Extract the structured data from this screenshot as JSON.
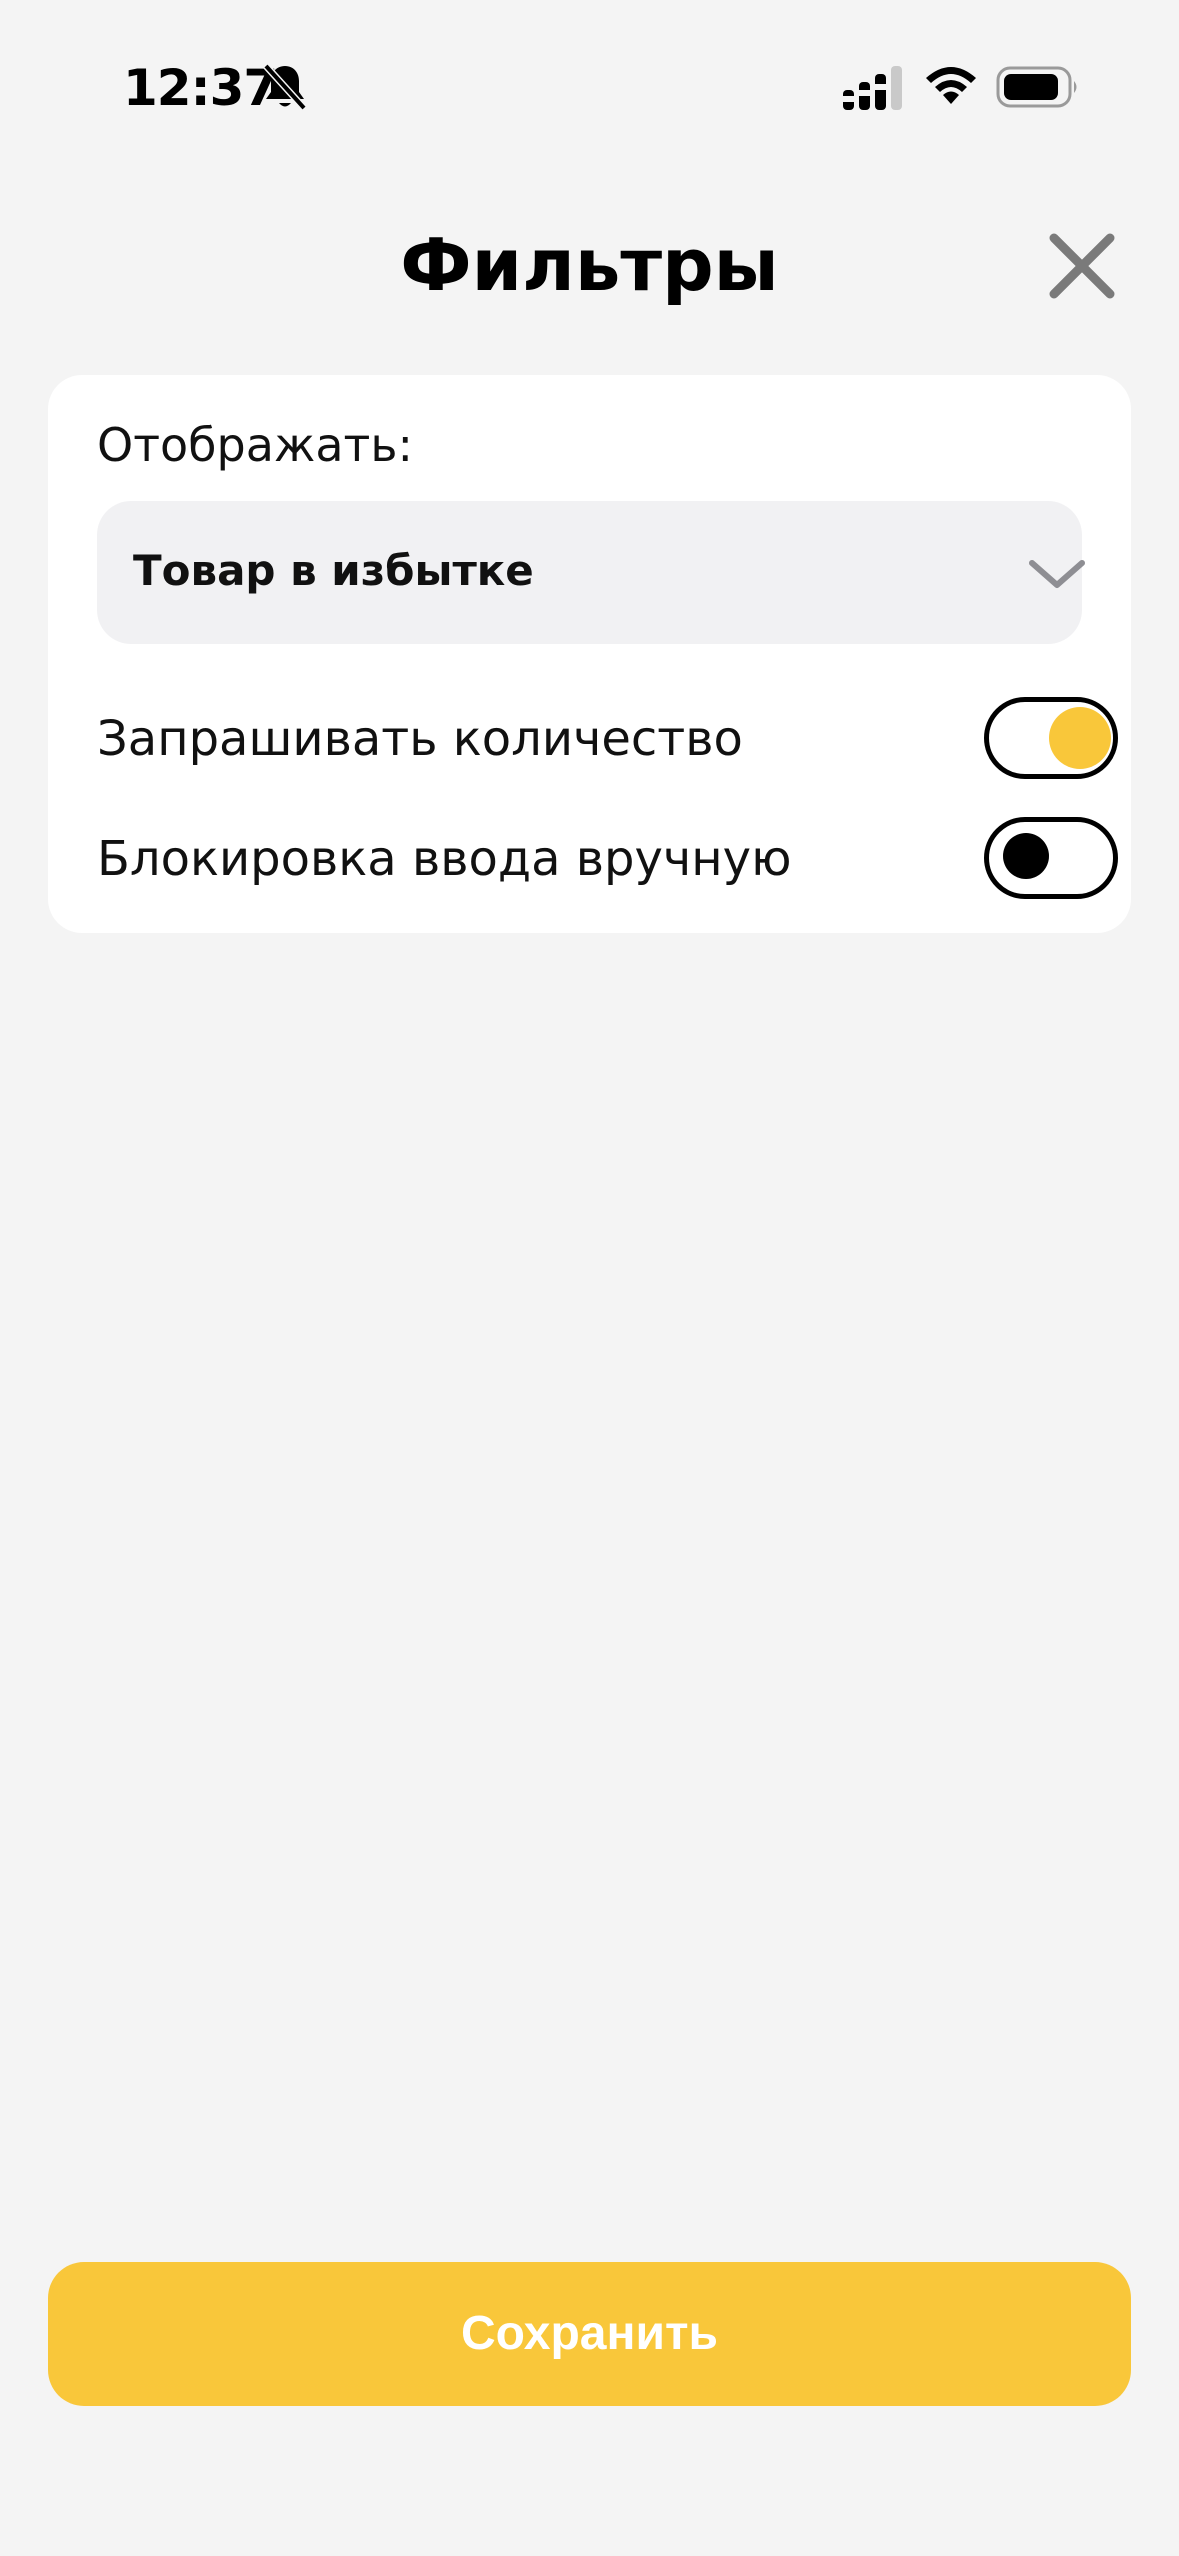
{
  "status_bar": {
    "time": "12:37",
    "icons": [
      "bell-slash-icon",
      "signal-icon",
      "wifi-icon",
      "battery-icon"
    ]
  },
  "header": {
    "title": "Фильтры",
    "close_icon": "close-icon"
  },
  "filters": {
    "display_label": "Отображать:",
    "display_selected": "Товар в избытке",
    "toggles": [
      {
        "label": "Запрашивать количество",
        "on": true
      },
      {
        "label": "Блокировка ввода вручную",
        "on": false
      }
    ]
  },
  "footer": {
    "save_label": "Сохранить"
  },
  "colors": {
    "accent": "#f9c73a",
    "background": "#f4f4f4",
    "card": "#ffffff",
    "select_bg": "#f1f1f3",
    "close_icon": "#7a7a7a",
    "chevron": "#8e8e93"
  }
}
